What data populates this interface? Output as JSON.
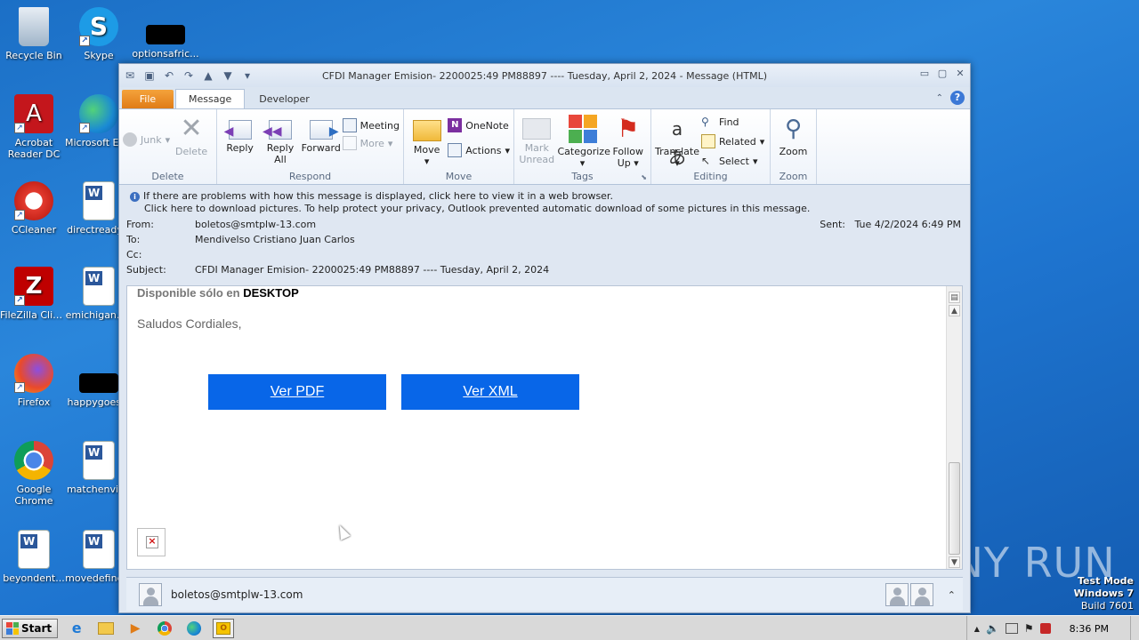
{
  "desktop": {
    "icons": [
      {
        "label": "Recycle Bin"
      },
      {
        "label": "Skype"
      },
      {
        "label": "optionsafric..."
      },
      {
        "label": "Acrobat Reader DC"
      },
      {
        "label": "Microsoft Edge"
      },
      {
        "label": "CCleaner"
      },
      {
        "label": "directready..."
      },
      {
        "label": "FileZilla Client"
      },
      {
        "label": "emichigan.r..."
      },
      {
        "label": "Firefox"
      },
      {
        "label": "happygoes..."
      },
      {
        "label": "Google Chrome"
      },
      {
        "label": "matchenvir..."
      },
      {
        "label": "beyondent..."
      },
      {
        "label": "movedefine..."
      }
    ]
  },
  "window": {
    "title": "CFDI Manager Emision-  2200025:49 PM88897  ---- Tuesday, April 2, 2024  -  Message (HTML)"
  },
  "tabs": {
    "file": "File",
    "message": "Message",
    "developer": "Developer"
  },
  "ribbon": {
    "delete": {
      "junk": "Junk",
      "delete": "Delete",
      "label": "Delete"
    },
    "respond": {
      "reply": "Reply",
      "reply_all": "Reply All",
      "forward": "Forward",
      "meeting": "Meeting",
      "more": "More",
      "label": "Respond"
    },
    "move": {
      "move": "Move",
      "onenote": "OneNote",
      "actions": "Actions",
      "label": "Move"
    },
    "tags": {
      "mark_unread": "Mark Unread",
      "categorize": "Categorize",
      "follow_up": "Follow Up",
      "label": "Tags"
    },
    "editing": {
      "translate": "Translate",
      "find": "Find",
      "related": "Related",
      "select": "Select",
      "label": "Editing"
    },
    "zoom": {
      "zoom": "Zoom",
      "label": "Zoom"
    }
  },
  "info": {
    "line1": "If there are problems with how this message is displayed, click here to view it in a web browser.",
    "line2": "Click here to download pictures. To help protect your privacy, Outlook prevented automatic download of some pictures in this message."
  },
  "header": {
    "from_label": "From:",
    "from": "boletos@smtplw-13.com",
    "to_label": "To:",
    "to": "Mendivelso Cristiano Juan Carlos",
    "cc_label": "Cc:",
    "cc": "",
    "subject_label": "Subject:",
    "subject": "CFDI Manager Emision-  2200025:49 PM88897  ---- Tuesday, April 2, 2024",
    "sent_label": "Sent:",
    "sent": "Tue 4/2/2024 6:49 PM"
  },
  "body": {
    "line1_prefix": "Disponible sólo en ",
    "line1_bold": "DESKTOP",
    "greeting": "Saludos Cordiales,",
    "btn_pdf": "Ver PDF",
    "btn_xml": "Ver XML"
  },
  "people_pane": {
    "email": "boletos@smtplw-13.com"
  },
  "taskbar": {
    "start": "Start",
    "time": "8:36 PM"
  },
  "watermark": {
    "line1": "Test Mode",
    "line2": "Windows 7",
    "line3": "Build 7601",
    "brand": "ANY RUN"
  },
  "colors": {
    "accent": "#0866e8",
    "file_tab": "#e07c17",
    "desktop": "#1e74cf"
  }
}
